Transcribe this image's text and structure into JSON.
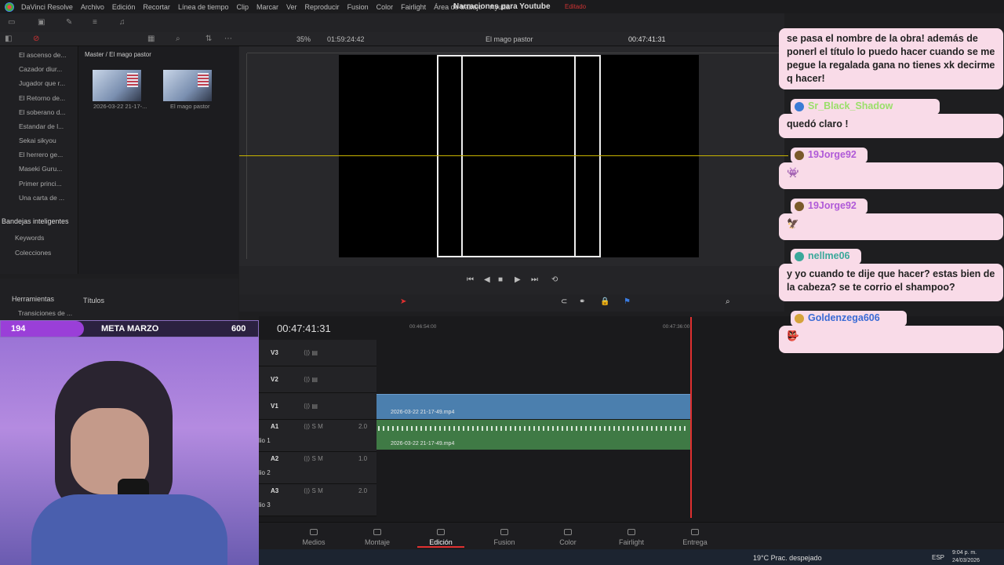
{
  "app": {
    "name": "DaVinci Resolve",
    "project_title": "Narraciones para Youtube",
    "edited": "Editado"
  },
  "menu": [
    "Archivo",
    "Edición",
    "Recortar",
    "Línea de tiempo",
    "Clip",
    "Marcar",
    "Ver",
    "Reproducir",
    "Fusion",
    "Color",
    "Fairlight",
    "Área de trabajo",
    "Ayuda"
  ],
  "toolbar": {
    "zoom": "35%",
    "timecode_left": "01:59:24:42",
    "timeline_name": "El mago pastor",
    "timecode_right": "00:47:41:31"
  },
  "bins": [
    "El ascenso de...",
    "Cazador diur...",
    "Jugador que r...",
    "El Retorno de...",
    "El soberano d...",
    "Estandar de l...",
    "Sekai sikyou",
    "El herrero ge...",
    "Maseki Guru...",
    "Primer princi...",
    "Una carta de ..."
  ],
  "smart_bins": {
    "header": "Bandejas inteligentes",
    "items": [
      "Keywords",
      "Colecciones"
    ]
  },
  "media": {
    "breadcrumb": "Master / El mago pastor",
    "items": [
      "2026-03-22 21-17-...",
      "El mago pastor"
    ]
  },
  "effects": {
    "tab1": "Herramientas",
    "tab2": "Títulos",
    "item": "Transiciones de ..."
  },
  "goal": {
    "left": "194",
    "title": "META MARZO",
    "right": "600",
    "progress": 0.323
  },
  "timeline": {
    "timecode": "00:47:41:31",
    "ruler": [
      "00:46:54:00",
      "00:47:36:00"
    ],
    "tracks": [
      {
        "name": "V3"
      },
      {
        "name": "V2"
      },
      {
        "name": "V1"
      },
      {
        "name": "A1",
        "level": "2.0"
      },
      {
        "name": "A2",
        "level": "1.0"
      },
      {
        "name": "A3",
        "level": "2.0"
      }
    ],
    "audio_names": [
      "lio 1",
      "lio 2",
      "lio 3"
    ],
    "clip_video": "2026-03-22 21-17-49.mp4",
    "clip_audio": "2026-03-22 21-17-49.mp4"
  },
  "pages": [
    "Medios",
    "Montaje",
    "Edición",
    "Fusion",
    "Color",
    "Fairlight",
    "Entrega"
  ],
  "active_page": "Edición",
  "taskbar": {
    "weather": "19°C  Prac. despejado",
    "lang": "ESP",
    "time": "9:04 p. m.",
    "date": "24/03/2026"
  },
  "chat": [
    {
      "user": "",
      "text": "se pasa el nombre de la obra! además de ponerl el título lo puedo hacer cuando se me pegue la regalada gana no tienes xk decirme q hacer!"
    },
    {
      "user": "Sr_Black_Shadow",
      "text": "quedó claro !"
    },
    {
      "user": "19Jorge92",
      "text": ""
    },
    {
      "user": "19Jorge92",
      "text": ""
    },
    {
      "user": "nellme06",
      "text": "y yo cuando te dije que hacer? estas bien de la cabeza? se te corrio el shampoo?"
    },
    {
      "user": "Goldenzega606",
      "text": ""
    }
  ],
  "colors": {
    "accent": "#e03030",
    "video_clip": "#4b7fae",
    "audio_clip": "#3f7a45",
    "chat_bg": "#f9dbe8",
    "username": "#b05ad8"
  }
}
